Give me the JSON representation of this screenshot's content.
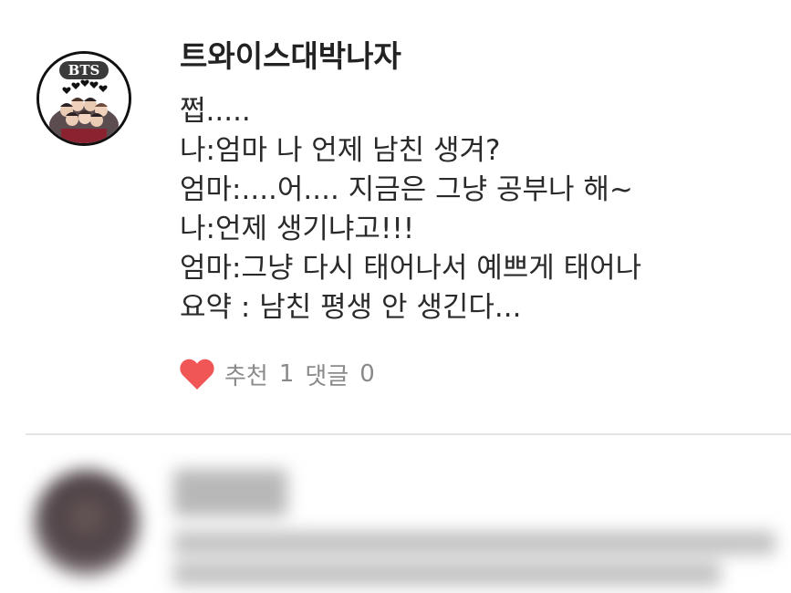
{
  "post": {
    "author": "트와이스대박나자",
    "avatar": {
      "icon": "bts-group-photo-avatar-icon",
      "badge_text": "BTS"
    },
    "body_lines": [
      "쩝.....",
      "나:엄마 나 언제 남친 생겨?",
      "엄마:....어.... 지금은 그냥 공부나 해~",
      "나:언제 생기냐고!!!",
      "엄마:그냥 다시 태어나서 예쁘게 태어나",
      "요약 : 남친 평생 안 생긴다..."
    ],
    "like_icon": "heart-icon",
    "like_color": "#f05656",
    "recommend_label": "추천",
    "recommend_count": "1",
    "comment_label": "댓글",
    "comment_count": "0"
  },
  "colors": {
    "text": "#2a2a2a",
    "meta_text": "#8a8a8a",
    "divider": "#e3e3e3"
  }
}
